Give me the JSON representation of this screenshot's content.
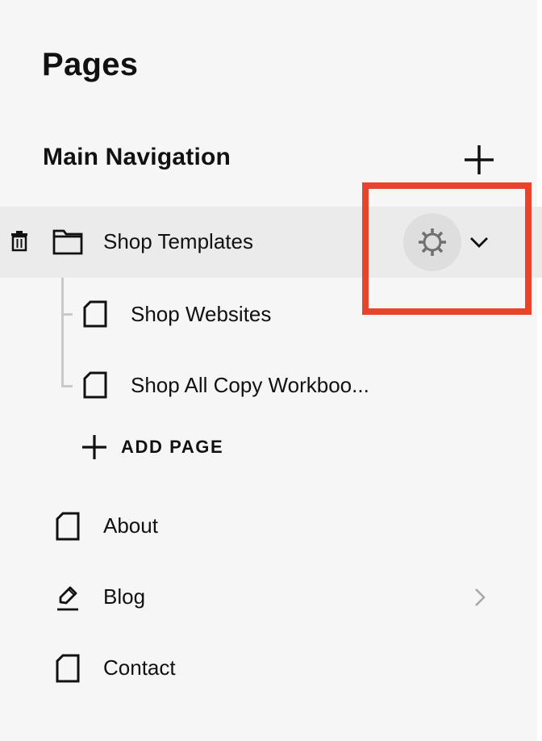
{
  "panel": {
    "title": "Pages",
    "section_title": "Main Navigation"
  },
  "selected_item": {
    "label": "Shop Templates"
  },
  "children": [
    {
      "label": "Shop Websites"
    },
    {
      "label": "Shop All Copy Workboo..."
    }
  ],
  "add_page_label": "ADD PAGE",
  "pages": [
    {
      "label": "About"
    },
    {
      "label": "Blog"
    },
    {
      "label": "Contact"
    }
  ],
  "colors": {
    "highlight": "#e8432b",
    "selected_row": "#ebebeb",
    "background": "#f6f6f6"
  }
}
